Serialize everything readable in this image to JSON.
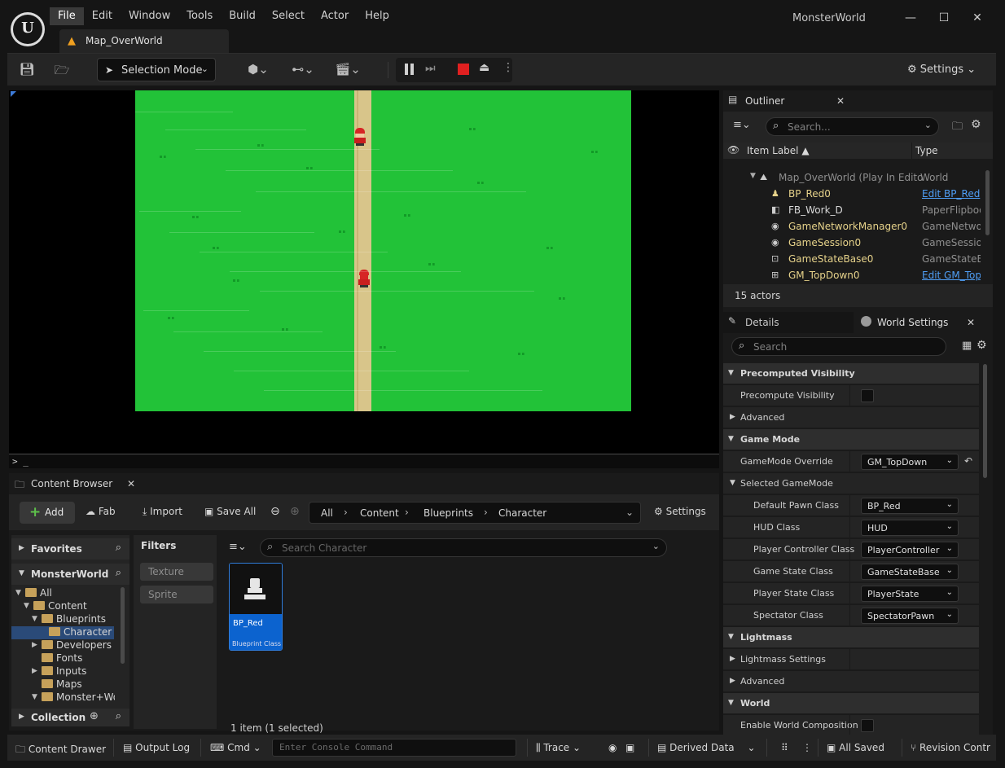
{
  "app": {
    "logo": "unreal-engine-logo",
    "title": "MonsterWorld",
    "menu": [
      "File",
      "Edit",
      "Window",
      "Tools",
      "Build",
      "Select",
      "Actor",
      "Help"
    ],
    "active_menu": "File",
    "document_tab": "Map_OverWorld"
  },
  "toolbar": {
    "selection_mode": "Selection Mode",
    "settings": "Settings"
  },
  "viewport": {
    "console_prompt": "> _",
    "ground_color": "#22c238",
    "path_color": "#d8c58a",
    "character_color": "#d62525"
  },
  "content_browser": {
    "tab": "Content Browser",
    "add": "Add",
    "fab": "Fab",
    "import": "Import",
    "save_all": "Save All",
    "settings": "Settings",
    "breadcrumb": [
      "All",
      "Content",
      "Blueprints",
      "Character"
    ],
    "favorites": "Favorites",
    "project": "MonsterWorld",
    "collection": "Collection",
    "tree": [
      {
        "label": "All"
      },
      {
        "label": "Content"
      },
      {
        "label": "Blueprints"
      },
      {
        "label": "Character",
        "selected": true
      },
      {
        "label": "Developers"
      },
      {
        "label": "Fonts"
      },
      {
        "label": "Inputs"
      },
      {
        "label": "Maps"
      },
      {
        "label": "Monster+Wo"
      }
    ],
    "filters_title": "Filters",
    "filter_chips": [
      "Texture",
      "Sprite"
    ],
    "search_placeholder": "Search Character",
    "asset": {
      "name": "BP_Red",
      "class": "Blueprint Class"
    },
    "item_count": "1 item (1 selected)"
  },
  "outliner": {
    "tab": "Outliner",
    "search_placeholder": "Search...",
    "col_label": "Item Label",
    "col_type": "Type",
    "rows": [
      {
        "label": "Map_OverWorld (Play In Edito",
        "type": "World",
        "icon": "world-icon"
      },
      {
        "label": "BP_Red0",
        "type": "Edit BP_Red",
        "icon": "pawn-icon"
      },
      {
        "label": "FB_Work_D",
        "type": "PaperFlipboo",
        "icon": "flipbook-icon"
      },
      {
        "label": "GameNetworkManager0",
        "type": "GameNetwor",
        "icon": "actor-icon"
      },
      {
        "label": "GameSession0",
        "type": "GameSession",
        "icon": "actor-icon"
      },
      {
        "label": "GameStateBase0",
        "type": "GameStateBa",
        "icon": "gamestate-icon"
      },
      {
        "label": "GM_TopDown0",
        "type": "Edit GM_TopI",
        "icon": "gamemode-icon"
      }
    ],
    "actor_count": "15 actors"
  },
  "details": {
    "tab_details": "Details",
    "tab_world": "World Settings",
    "search_placeholder": "Search",
    "categories": {
      "precomputed": "Precomputed Visibility",
      "precompute_visibility": "Precompute Visibility",
      "advanced": "Advanced",
      "game_mode": "Game Mode",
      "gamemode_override": "GameMode Override",
      "gamemode_override_value": "GM_TopDown",
      "selected_gamemode": "Selected GameMode",
      "lightmass": "Lightmass",
      "lightmass_settings": "Lightmass Settings",
      "advanced2": "Advanced",
      "world": "World",
      "enable_world_composition": "Enable World Composition"
    },
    "classes": [
      {
        "label": "Default Pawn Class",
        "value": "BP_Red"
      },
      {
        "label": "HUD Class",
        "value": "HUD"
      },
      {
        "label": "Player Controller Class",
        "value": "PlayerController"
      },
      {
        "label": "Game State Class",
        "value": "GameStateBase"
      },
      {
        "label": "Player State Class",
        "value": "PlayerState"
      },
      {
        "label": "Spectator Class",
        "value": "SpectatorPawn"
      }
    ]
  },
  "statusbar": {
    "content_drawer": "Content Drawer",
    "output_log": "Output Log",
    "cmd": "Cmd",
    "console_placeholder": "Enter Console Command",
    "trace": "Trace",
    "derived_data": "Derived Data",
    "all_saved": "All Saved",
    "revision_control": "Revision Contr"
  }
}
